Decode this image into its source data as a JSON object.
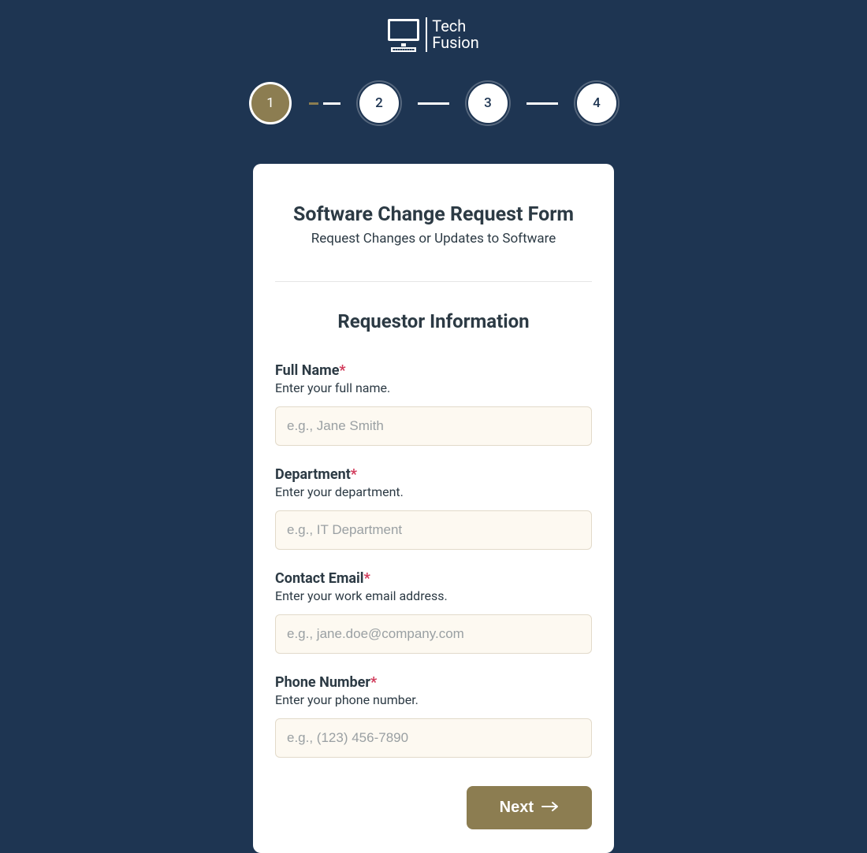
{
  "brand": {
    "line1": "Tech",
    "line2": "Fusion"
  },
  "stepper": {
    "steps": [
      "1",
      "2",
      "3",
      "4"
    ],
    "active_index": 0
  },
  "form": {
    "title": "Software Change Request Form",
    "subtitle": "Request Changes or Updates to Software",
    "section_heading": "Requestor Information",
    "fields": {
      "full_name": {
        "label": "Full Name",
        "required": true,
        "help": "Enter your full name.",
        "placeholder": "e.g., Jane Smith",
        "value": ""
      },
      "department": {
        "label": "Department",
        "required": true,
        "help": "Enter your department.",
        "placeholder": "e.g., IT Department",
        "value": ""
      },
      "contact_email": {
        "label": "Contact Email",
        "required": true,
        "help": "Enter your work email address.",
        "placeholder": "e.g., jane.doe@company.com",
        "value": ""
      },
      "phone_number": {
        "label": "Phone Number",
        "required": true,
        "help": "Enter your phone number.",
        "placeholder": "e.g., (123) 456-7890",
        "value": ""
      }
    },
    "actions": {
      "next_label": "Next"
    }
  },
  "colors": {
    "page_bg": "#1e3552",
    "accent": "#8c7d51",
    "input_bg": "#fdf9f1",
    "text": "#2c3a44",
    "required": "#d13a5a"
  }
}
